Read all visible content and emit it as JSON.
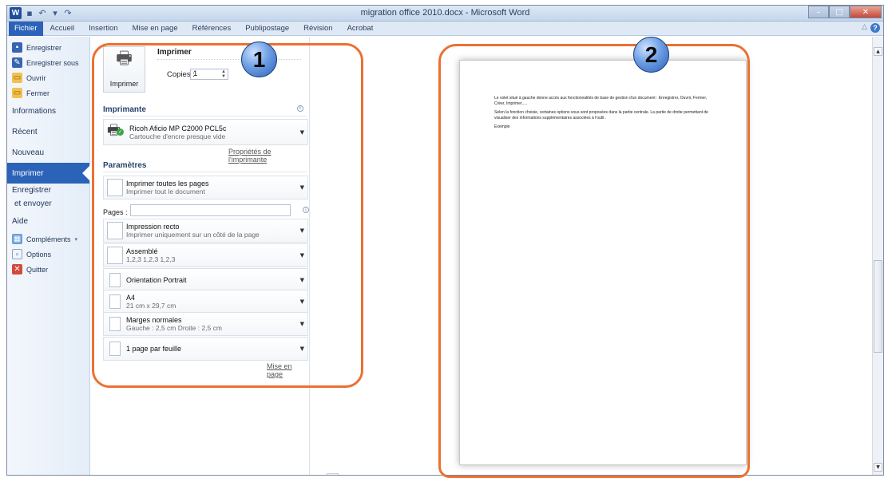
{
  "window": {
    "title": "migration office 2010.docx  -  Microsoft Word",
    "logo_letter": "W"
  },
  "ribbon": {
    "tabs": [
      "Fichier",
      "Accueil",
      "Insertion",
      "Mise en page",
      "Références",
      "Publipostage",
      "Révision",
      "Acrobat"
    ],
    "help_symbol": "?"
  },
  "nav": {
    "save": "Enregistrer",
    "save_as": "Enregistrer sous",
    "open": "Ouvrir",
    "close": "Fermer",
    "info": "Informations",
    "recent": "Récent",
    "new": "Nouveau",
    "print": "Imprimer",
    "send_line1": "Enregistrer",
    "send_line2": "et envoyer",
    "help": "Aide",
    "addins": "Compléments",
    "options": "Options",
    "quit": "Quitter"
  },
  "print": {
    "heading": "Imprimer",
    "button_label": "Imprimer",
    "copies_label": "Copies :",
    "copies_value": "1"
  },
  "printer": {
    "section": "Imprimante",
    "name": "Ricoh Aficio MP C2000 PCL5c",
    "status": "Cartouche d'encre presque vide",
    "properties_link": "Propriétés de l'imprimante"
  },
  "settings": {
    "section": "Paramètres",
    "pages_label": "Pages :",
    "items": [
      {
        "l1": "Imprimer toutes les pages",
        "l2": "Imprimer tout le document"
      },
      {
        "l1": "Impression recto",
        "l2": "Imprimer uniquement sur un côté de la page"
      },
      {
        "l1": "Assemblé",
        "l2": "1,2,3   1,2,3   1,2,3"
      },
      {
        "l1": "Orientation Portrait",
        "l2": ""
      },
      {
        "l1": "A4",
        "l2": "21 cm x 29,7 cm"
      },
      {
        "l1": "Marges normales",
        "l2": "Gauche : 2,5 cm   Droite : 2,5 cm"
      },
      {
        "l1": "1 page par feuille",
        "l2": ""
      }
    ],
    "page_setup_link": "Mise en page"
  },
  "preview": {
    "paragraphs": [
      "Le volet situé à gauche donne accès aux fonctionnalités de base de gestion d'un document : Enregistrer, Ouvrir, Fermer, Créer, Imprimer.....",
      "Selon la fonction choisie, certaines options vous sont proposées dans la partie centrale. La partie de droite permettant de visualiser des informations supplémentaires associées à l'outil .",
      "Exemple"
    ]
  },
  "annotations": {
    "one": "1",
    "two": "2",
    "color": "#ec7032"
  }
}
